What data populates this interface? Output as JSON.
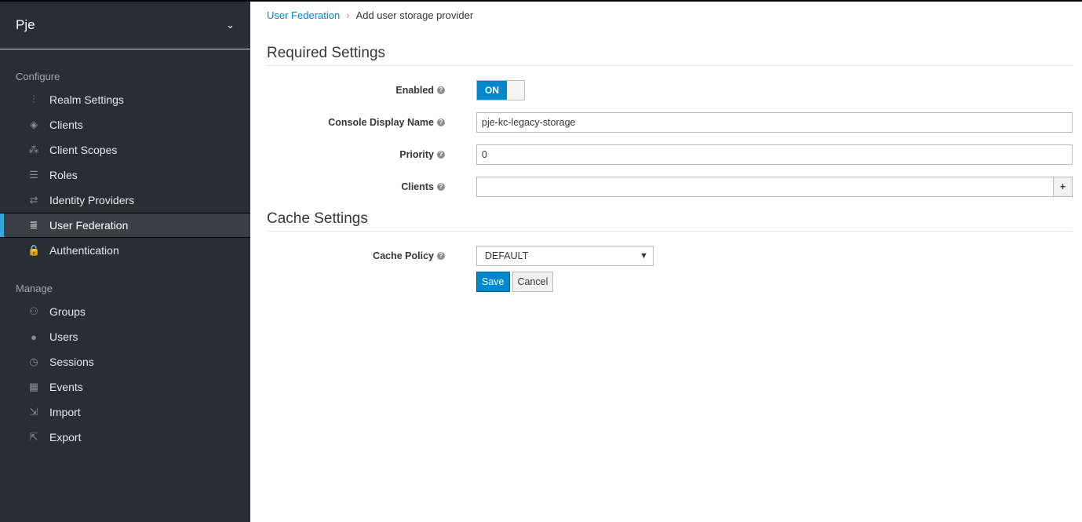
{
  "sidebar": {
    "realm": "Pje",
    "configure_label": "Configure",
    "manage_label": "Manage",
    "configure": [
      {
        "label": "Realm Settings",
        "icon": "sliders-icon"
      },
      {
        "label": "Clients",
        "icon": "cube-icon"
      },
      {
        "label": "Client Scopes",
        "icon": "cubes-icon"
      },
      {
        "label": "Roles",
        "icon": "list-icon"
      },
      {
        "label": "Identity Providers",
        "icon": "exchange-icon"
      },
      {
        "label": "User Federation",
        "icon": "database-icon",
        "active": true
      },
      {
        "label": "Authentication",
        "icon": "lock-icon"
      }
    ],
    "manage": [
      {
        "label": "Groups",
        "icon": "users-icon"
      },
      {
        "label": "Users",
        "icon": "user-icon"
      },
      {
        "label": "Sessions",
        "icon": "clock-icon"
      },
      {
        "label": "Events",
        "icon": "calendar-icon"
      },
      {
        "label": "Import",
        "icon": "import-icon"
      },
      {
        "label": "Export",
        "icon": "export-icon"
      }
    ]
  },
  "breadcrumb": {
    "parent": "User Federation",
    "current": "Add user storage provider"
  },
  "required": {
    "title": "Required Settings",
    "enabled_label": "Enabled",
    "enabled_value": "ON",
    "display_name_label": "Console Display Name",
    "display_name_value": "pje-kc-legacy-storage",
    "priority_label": "Priority",
    "priority_value": "0",
    "clients_label": "Clients",
    "clients_value": "",
    "add": "+"
  },
  "cache": {
    "title": "Cache Settings",
    "policy_label": "Cache Policy",
    "policy_value": "DEFAULT"
  },
  "buttons": {
    "save": "Save",
    "cancel": "Cancel"
  },
  "colors": {
    "accent": "#0088ce",
    "sidebar": "#292e34",
    "active_bar": "#39a5dc"
  }
}
